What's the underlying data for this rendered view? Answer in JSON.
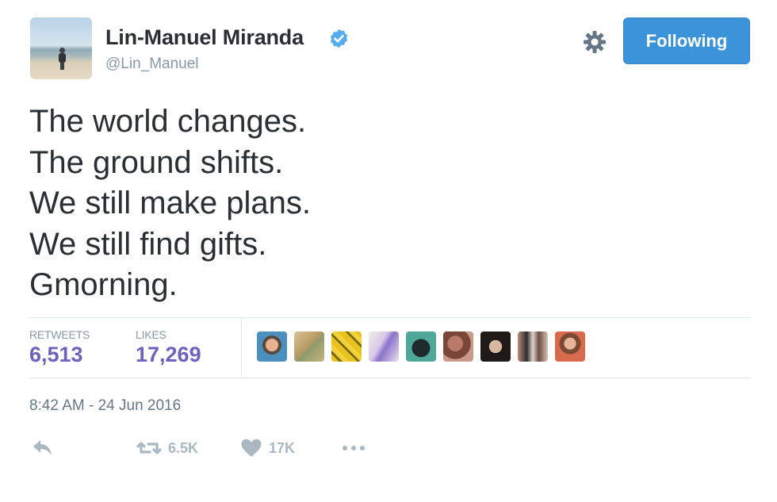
{
  "tweet": {
    "author_name": "Lin-Manuel Miranda",
    "author_handle": "@Lin_Manuel",
    "verified": true,
    "follow_button_label": "Following",
    "text_lines": [
      "The world changes.",
      "The ground shifts.",
      "We still make plans.",
      "We still find gifts.",
      "Gmorning."
    ],
    "stats": {
      "retweets_label": "RETWEETS",
      "retweets_value": "6,513",
      "likes_label": "LIKES",
      "likes_value": "17,269"
    },
    "timestamp": "8:42 AM - 24 Jun 2016",
    "actions": {
      "retweet_count": "6.5K",
      "like_count": "17K"
    }
  },
  "colors": {
    "follow_button": "#3b94d9",
    "stat_value": "#6f60c0",
    "verified_badge": "#55acee",
    "action_icon": "#aab8c2"
  },
  "icons": [
    "verified-badge-icon",
    "gear-icon",
    "reply-icon",
    "retweet-icon",
    "heart-icon",
    "more-icon"
  ]
}
